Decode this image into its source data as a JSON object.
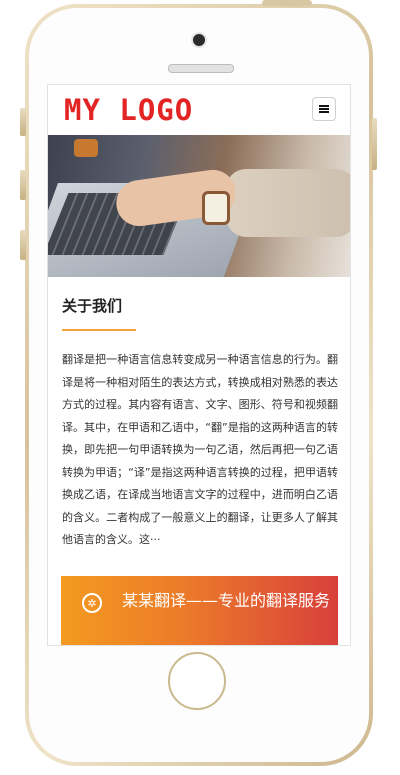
{
  "header": {
    "logo_text": "MY LOGO",
    "menu_icon": "hamburger-icon"
  },
  "hero": {
    "image_subject": "hands typing on laptop keyboard"
  },
  "about": {
    "title": "关于我们",
    "body": "翻译是把一种语言信息转变成另一种语言信息的行为。翻译是将一种相对陌生的表达方式，转换成相对熟悉的表达方式的过程。其内容有语言、文字、图形、符号和视频翻译。其中，在甲语和乙语中，“翻”是指的这两种语言的转换，即先把一句甲语转换为一句乙语，然后再把一句乙语转换为甲语；“译”是指这两种语言转换的过程，把甲语转换成乙语，在译成当地语言文字的过程中，进而明白乙语的含义。二者构成了一般意义上的翻译，让更多人了解其他语言的含义。这···"
  },
  "banner": {
    "icon": "gear-icon",
    "text": "某某翻译——专业的翻译服务"
  },
  "colors": {
    "logo": "#e32424",
    "accent_underline": "#f3a23a",
    "banner_start": "#f39a1f",
    "banner_end": "#d8403b"
  }
}
